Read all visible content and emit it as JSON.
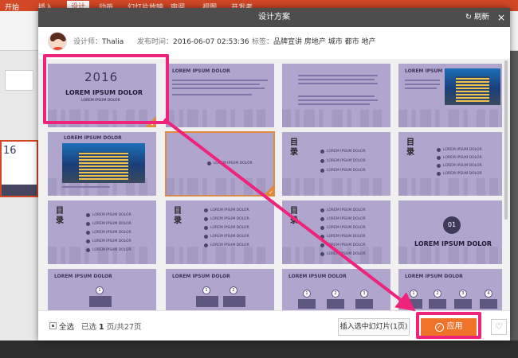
{
  "app": {
    "tabs": [
      "开始",
      "插入",
      "设计",
      "动画",
      "幻灯片放映",
      "审阅",
      "视图",
      "开发者"
    ],
    "active_tab": "设计",
    "thumb_year": "16"
  },
  "dialog": {
    "title": "设计方案",
    "refresh_label": "刷新",
    "close_label": "×",
    "designer_label": "设计师：",
    "designer_name": "Thalia",
    "publish_label": "发布时间：",
    "publish_time": "2016-06-07 02:53:36",
    "tags_label": "标签：",
    "tags": "品牌宣讲 房地产 城市 都市 地产"
  },
  "slides": {
    "s1": {
      "year": "2016",
      "title": "LOREM IPSUM DOLOR",
      "subtitle": "LOREM IPSUM DOLOR"
    },
    "s2": {
      "heading": "LOREM IPSUM DOLOR"
    },
    "s4": {
      "heading": "LOREM IPSUM DOLOR"
    },
    "s5": {
      "heading": "LOREM IPSUM DOLOR"
    },
    "toc_title": "目录",
    "toc_item": "LOREM IPSUM DOLOR",
    "s12": {
      "number": "01",
      "title": "LOREM IPSUM DOLOR"
    },
    "row4_heading": "LOREM IPSUM DOLOR",
    "step_labels": [
      "1",
      "2",
      "3",
      "4"
    ]
  },
  "footer": {
    "select_all": "全选",
    "selected_prefix": "已选",
    "selected_count": "1",
    "selected_suffix": "页/共27页",
    "insert_button": "插入选中幻灯片(1页)",
    "apply_button": "应用",
    "favorite_icon": "heart-icon"
  },
  "colors": {
    "title_bar": "#4d4d4d",
    "slide_bg": "#b0a5cc",
    "apply_orange": "#f0732a",
    "highlight_pink": "#f0237a"
  }
}
